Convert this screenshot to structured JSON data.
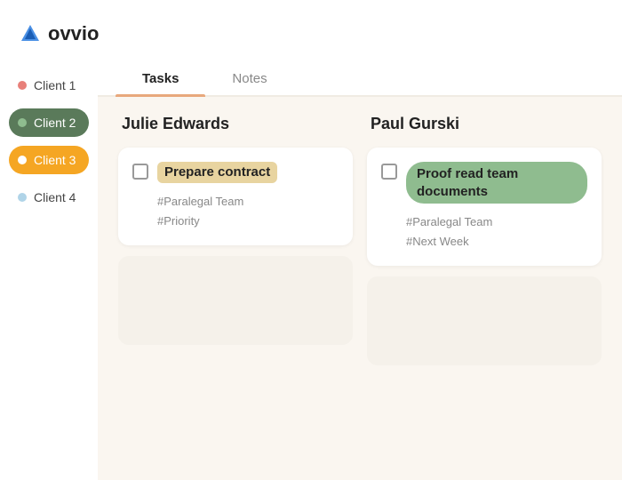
{
  "logo": {
    "text": "ovvio"
  },
  "sidebar": {
    "items": [
      {
        "id": "client1",
        "label": "Client 1",
        "dot_color": "#e8807a",
        "state": "normal"
      },
      {
        "id": "client2",
        "label": "Client 2",
        "dot_color": "#5a7a5a",
        "state": "active-green"
      },
      {
        "id": "client3",
        "label": "Client 3",
        "dot_color": "#f5a623",
        "state": "active-orange"
      },
      {
        "id": "client4",
        "label": "Client 4",
        "dot_color": "#b0d4e8",
        "state": "normal"
      }
    ]
  },
  "tabs": [
    {
      "id": "tasks",
      "label": "Tasks",
      "active": true
    },
    {
      "id": "notes",
      "label": "Notes",
      "active": false
    }
  ],
  "board": {
    "columns": [
      {
        "id": "julie",
        "title": "Julie Edwards",
        "cards": [
          {
            "id": "task1",
            "label": "Prepare contract",
            "highlight": "yellow",
            "tags": [
              "#Paralegal Team",
              "#Priority"
            ]
          }
        ]
      },
      {
        "id": "paul",
        "title": "Paul Gurski",
        "cards": [
          {
            "id": "task2",
            "label": "Proof read team documents",
            "highlight": "green",
            "tags": [
              "#Paralegal Team",
              "#Next Week"
            ]
          }
        ]
      }
    ]
  }
}
